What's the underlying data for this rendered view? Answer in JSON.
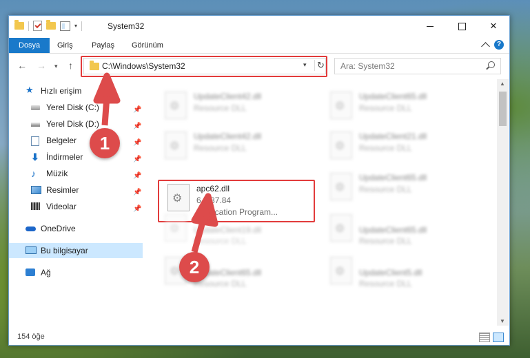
{
  "window": {
    "title": "System32"
  },
  "ribbon": {
    "tabs": [
      "Dosya",
      "Giriş",
      "Paylaş",
      "Görünüm"
    ]
  },
  "nav": {
    "address": "C:\\Windows\\System32",
    "search_placeholder": "Ara: System32"
  },
  "sidebar": {
    "quick_access": "Hızlı erişim",
    "items": [
      {
        "label": "Yerel Disk (C:)",
        "icon": "drive-icon"
      },
      {
        "label": "Yerel Disk (D:)",
        "icon": "drive-icon"
      },
      {
        "label": "Belgeler",
        "icon": "documents-icon"
      },
      {
        "label": "İndirmeler",
        "icon": "downloads-icon"
      },
      {
        "label": "Müzik",
        "icon": "music-icon"
      },
      {
        "label": "Resimler",
        "icon": "pictures-icon"
      },
      {
        "label": "Videolar",
        "icon": "videos-icon"
      }
    ],
    "onedrive": "OneDrive",
    "this_pc": "Bu bilgisayar",
    "network": "Ağ"
  },
  "files": [
    {
      "name": "UpdateClient42.dll",
      "desc": "Resource DLL",
      "type": ""
    },
    {
      "name": "UpdateClient65.dll",
      "desc": "Resource DLL",
      "type": ""
    },
    {
      "name": "UpdateClient42.dll",
      "desc": "Resource DLL",
      "type": ""
    },
    {
      "name": "UpdateClient21.dll",
      "desc": "Resource DLL",
      "type": ""
    },
    {
      "name": "apc62.dll",
      "desc": "6.1.87.84",
      "type": "Application Program..."
    },
    {
      "name": "UpdateClient65.dll",
      "desc": "Resource DLL",
      "type": ""
    },
    {
      "name": "UpdateClient19.dll",
      "desc": "Resource DLL",
      "type": ""
    },
    {
      "name": "UpdateClient65.dll",
      "desc": "Resource DLL",
      "type": ""
    },
    {
      "name": "UpdateClient65.dll",
      "desc": "Resource DLL",
      "type": ""
    },
    {
      "name": "UpdateClient5.dll",
      "desc": "Resource DLL",
      "type": ""
    }
  ],
  "status": {
    "count": "154 öğe"
  },
  "markers": [
    "1",
    "2"
  ],
  "colors": {
    "accent": "#1979ca",
    "highlight": "#e23b3b",
    "marker": "#dd4b4b",
    "selection": "#cce8ff"
  }
}
